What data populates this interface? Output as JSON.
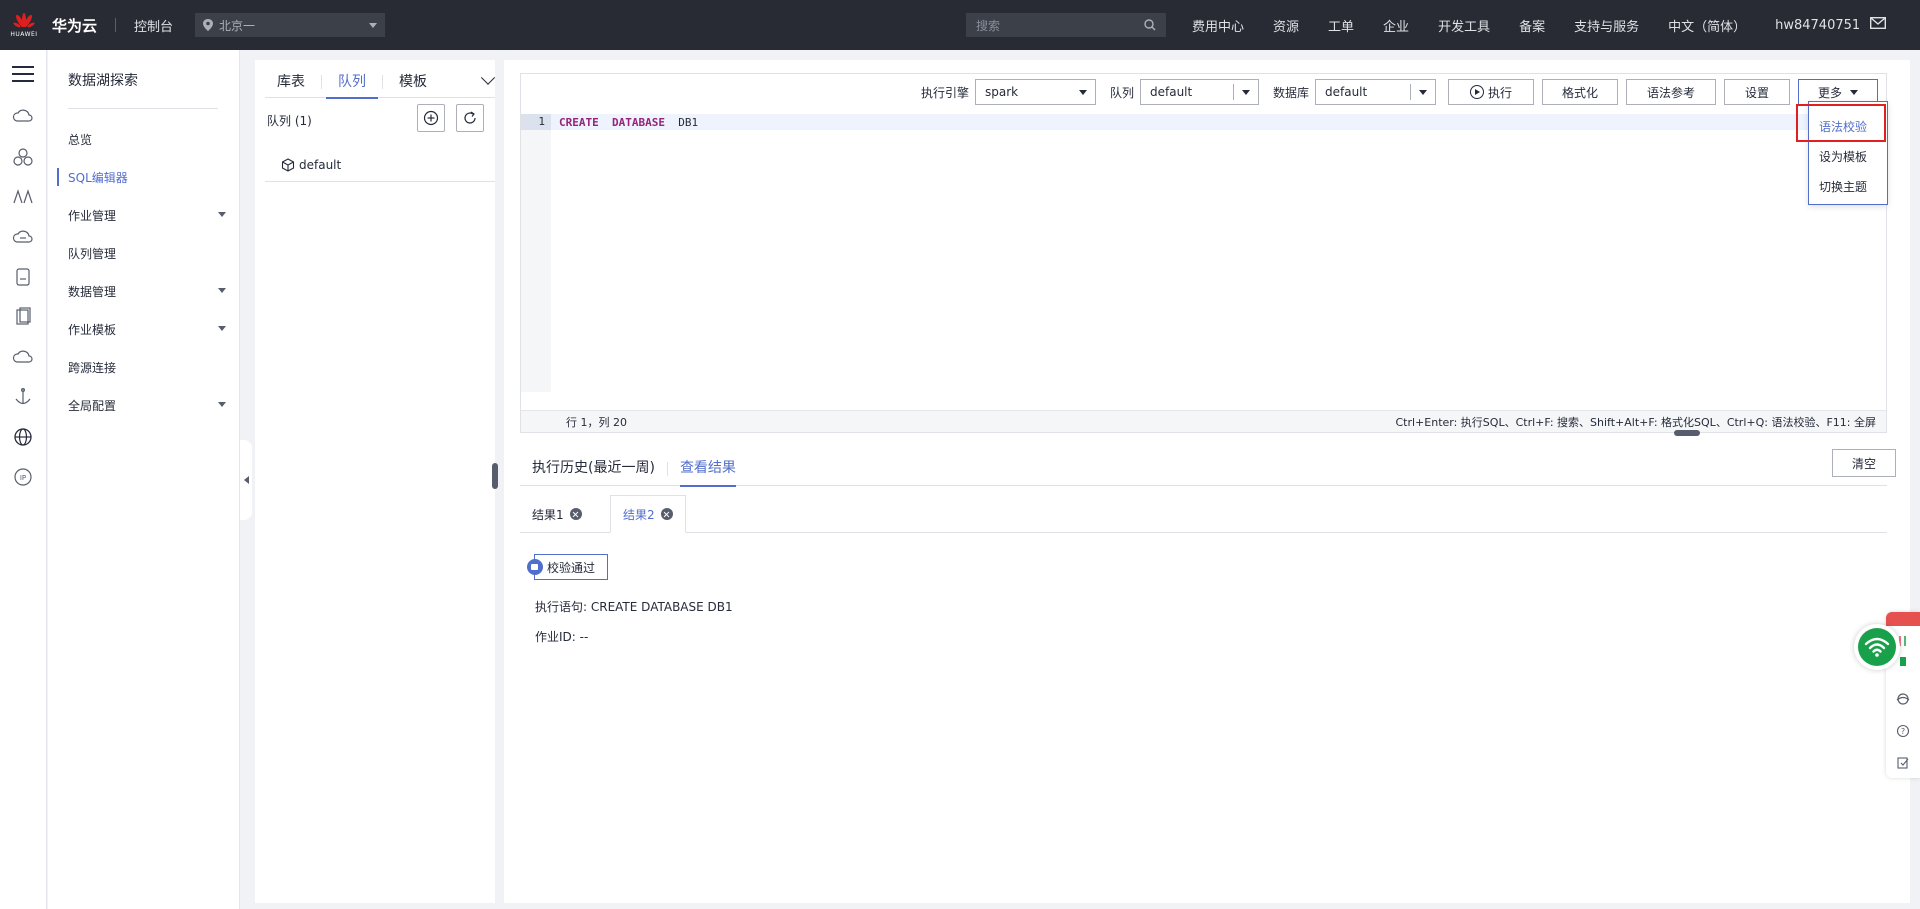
{
  "header": {
    "logo_text": "HUAWEI",
    "brand": "华为云",
    "console": "控制台",
    "region": "北京一",
    "search_placeholder": "搜索",
    "nav": [
      "费用中心",
      "资源",
      "工单",
      "企业",
      "开发工具",
      "备案",
      "支持与服务",
      "中文（简体）",
      "hw84740751"
    ]
  },
  "sidenav": {
    "title": "数据湖探索",
    "items": [
      {
        "label": "总览",
        "expandable": false,
        "active": false
      },
      {
        "label": "SQL编辑器",
        "expandable": false,
        "active": true
      },
      {
        "label": "作业管理",
        "expandable": true,
        "active": false
      },
      {
        "label": "队列管理",
        "expandable": false,
        "active": false
      },
      {
        "label": "数据管理",
        "expandable": true,
        "active": false
      },
      {
        "label": "作业模板",
        "expandable": true,
        "active": false
      },
      {
        "label": "跨源连接",
        "expandable": false,
        "active": false
      },
      {
        "label": "全局配置",
        "expandable": true,
        "active": false
      }
    ]
  },
  "objects": {
    "tabs": [
      "库表",
      "队列",
      "模板"
    ],
    "active_tab": "队列",
    "queue_count_label": "队列 (1)",
    "queues": [
      "default"
    ]
  },
  "editor": {
    "engine_label": "执行引擎",
    "engine_value": "spark",
    "queue_label": "队列",
    "queue_value": "default",
    "db_label": "数据库",
    "db_value": "default",
    "buttons": {
      "run": "执行",
      "format": "格式化",
      "syntax_ref": "语法参考",
      "settings": "设置",
      "more": "更多"
    },
    "line_number": "1",
    "code_kw1": "CREATE",
    "code_kw2": "DATABASE",
    "code_id": "DB1",
    "cursor_pos": "行 1，列 20",
    "shortcuts": "Ctrl+Enter: 执行SQL、Ctrl+F: 搜索、Shift+Alt+F: 格式化SQL、Ctrl+Q: 语法校验、F11: 全屏"
  },
  "more_menu": [
    "语法校验",
    "设为模板",
    "切换主题"
  ],
  "results": {
    "tabs": [
      "执行历史(最近一周)",
      "查看结果"
    ],
    "active_tab": "查看结果",
    "clear_button": "清空",
    "result_tabs": [
      "结果1",
      "结果2"
    ],
    "active_result": "结果2",
    "pass_badge": "校验通过",
    "statement": "执行语句: CREATE DATABASE DB1",
    "job_id": "作业ID: --"
  },
  "colors": {
    "accent": "#526ecc",
    "topbar": "#282b33",
    "highlight_box": "#e02020",
    "keyword": "#95247a"
  }
}
